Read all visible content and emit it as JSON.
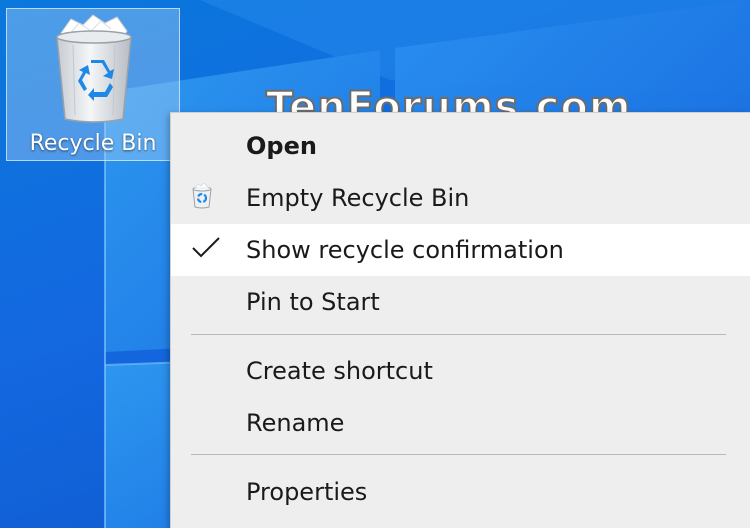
{
  "desktop": {
    "icon_label": "Recycle Bin",
    "watermark": "TenForums.com"
  },
  "context_menu": {
    "items": [
      {
        "label": "Open",
        "bold": true
      },
      {
        "label": "Empty Recycle Bin",
        "icon": "recycle-bin-icon"
      },
      {
        "label": "Show recycle confirmation",
        "checked": true,
        "highlighted": true
      },
      {
        "label": "Pin to Start"
      },
      {
        "label": "Create shortcut"
      },
      {
        "label": "Rename"
      },
      {
        "label": "Properties"
      }
    ]
  },
  "colors": {
    "desktop_accent": "#1468e0",
    "menu_background": "#eeeeee",
    "menu_highlight": "#ffffff",
    "recycle_arrow": "#1e88e5"
  }
}
